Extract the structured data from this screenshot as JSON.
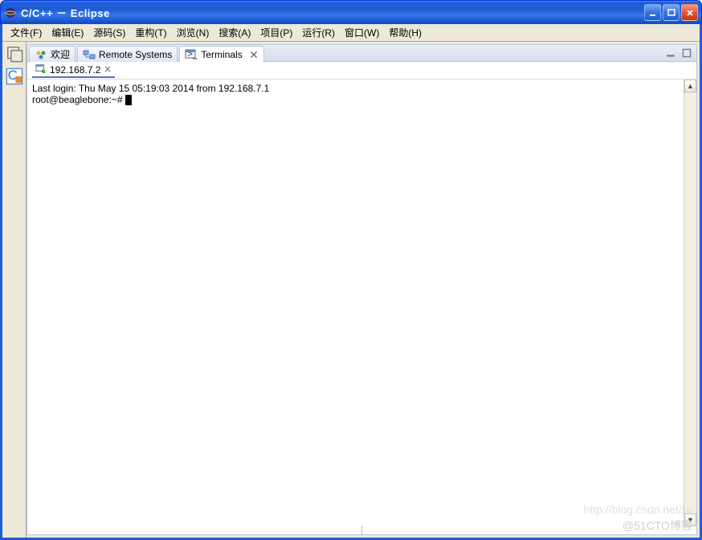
{
  "window": {
    "title": "C/C++ － Eclipse"
  },
  "menu": {
    "file": "文件(F)",
    "edit": "编辑(E)",
    "source": "源码(S)",
    "refactor": "重构(T)",
    "browse": "浏览(N)",
    "search": "搜索(A)",
    "project": "项目(P)",
    "run": "运行(R)",
    "window": "窗口(W)",
    "help": "帮助(H)"
  },
  "view_tabs": {
    "welcome": "欢迎",
    "remote": "Remote Systems",
    "terminals": "Terminals"
  },
  "connection": {
    "host": "192.168.7.2"
  },
  "terminal": {
    "line1": "Last login: Thu May 15 05:19:03 2014 from 192.168.7.1",
    "prompt": "root@beaglebone:~# "
  },
  "watermark": "@51CTO博客",
  "watermark2": "http://blog.csdn.net/lw"
}
